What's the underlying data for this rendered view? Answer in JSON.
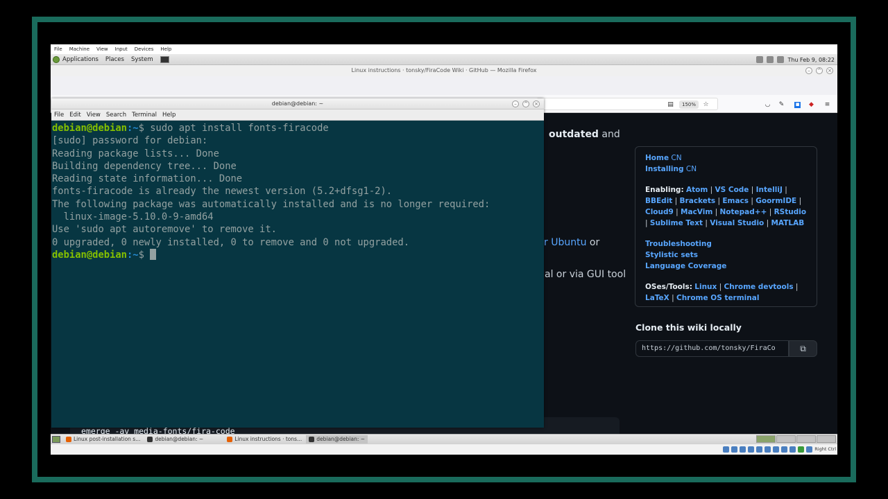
{
  "vm_menu": [
    "File",
    "Machine",
    "View",
    "Input",
    "Devices",
    "Help"
  ],
  "top_panel": {
    "menus": [
      "Applications",
      "Places",
      "System"
    ],
    "clock": "Thu Feb 9, 08:22"
  },
  "firefox": {
    "title": "Linux instructions · tonsky/FiraCode Wiki · GitHub — Mozilla Firefox",
    "zoom": "150%",
    "content": {
      "line1_bold": "outdated",
      "line1_tail": " and",
      "line2_link": "r Ubuntu",
      "line2_tail": " or",
      "line3": "al or via GUI tool"
    },
    "sidebar": {
      "home": "Home",
      "home_cn": "CN",
      "installing": "Installing",
      "installing_cn": "CN",
      "enabling_label": "Enabling:",
      "enabling": [
        "Atom",
        "VS Code",
        "IntelliJ",
        "BBEdit",
        "Brackets",
        "Emacs",
        "GoormIDE",
        "Cloud9",
        "MacVim",
        "Notepad++",
        "RStudio",
        "Sublime Text",
        "Visual Studio",
        "MATLAB"
      ],
      "troubleshooting": "Troubleshooting",
      "stylistic": "Stylistic sets",
      "coverage": "Language Coverage",
      "oses_label": "OSes/Tools:",
      "oses": [
        "Linux",
        "Chrome devtools",
        "LaTeX",
        "Chrome OS terminal"
      ]
    },
    "clone": {
      "title": "Clone this wiki locally",
      "url": "https://github.com/tonsky/FiraCo"
    },
    "code_block": "emerge -av media-fonts/fira-code"
  },
  "terminal": {
    "title": "debian@debian: ~",
    "menu": [
      "File",
      "Edit",
      "View",
      "Search",
      "Terminal",
      "Help"
    ],
    "prompt_user": "debian@debian",
    "prompt_path": ":~",
    "prompt_dollar": "$",
    "command": " sudo apt install fonts-firacode",
    "output": [
      "[sudo] password for debian:",
      "Reading package lists... Done",
      "Building dependency tree... Done",
      "Reading state information... Done",
      "fonts-firacode is already the newest version (5.2+dfsg1-2).",
      "The following package was automatically installed and is no longer required:",
      "  linux-image-5.10.0-9-amd64",
      "Use 'sudo apt autoremove' to remove it.",
      "0 upgraded, 0 newly installed, 0 to remove and 0 not upgraded."
    ]
  },
  "taskbar": [
    {
      "label": "Linux post-installation s...",
      "icon": "firefox-icon",
      "color": "#e66000"
    },
    {
      "label": "debian@debian: ~",
      "icon": "terminal-icon",
      "color": "#333333"
    },
    {
      "label": "Linux instructions · tons...",
      "icon": "firefox-icon",
      "color": "#e66000"
    },
    {
      "label": "debian@debian: ~",
      "icon": "terminal-icon",
      "color": "#333333"
    }
  ],
  "host_key": "Right Ctrl",
  "colors": {
    "frame": "#1a6b5c",
    "terminal_bg": "#073642",
    "prompt_user": "#85c000",
    "github_bg": "#0d1117",
    "link": "#58a6ff"
  }
}
